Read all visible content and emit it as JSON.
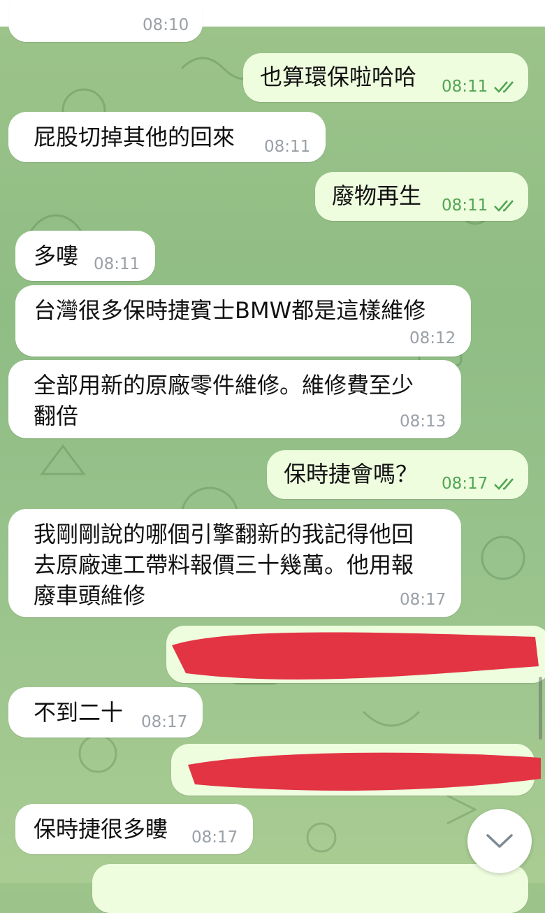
{
  "colors": {
    "incoming_bubble": "#ffffff",
    "outgoing_bubble": "#eefdde",
    "outgoing_time": "#52a553",
    "incoming_time": "#9aa0a6",
    "read_check": "#52a553",
    "redaction_mark": "#e33444"
  },
  "messages": [
    {
      "id": "m0",
      "direction": "in",
      "text": "",
      "time": "08:10",
      "partially_visible": true
    },
    {
      "id": "m1",
      "direction": "out",
      "text": "也算環保啦哈哈",
      "time": "08:11",
      "status": "read"
    },
    {
      "id": "m2",
      "direction": "in",
      "text": "屁股切掉其他的回來",
      "time": "08:11"
    },
    {
      "id": "m3",
      "direction": "out",
      "text": "廢物再生",
      "time": "08:11",
      "status": "read"
    },
    {
      "id": "m4",
      "direction": "in",
      "text": "多嘍",
      "time": "08:11"
    },
    {
      "id": "m5",
      "direction": "in",
      "text": "台灣很多保時捷賓士BMW都是這樣維修",
      "time": "08:12"
    },
    {
      "id": "m6",
      "direction": "in",
      "text": "全部用新的原廠零件維修。維修費至少\n翻倍",
      "time": "08:13"
    },
    {
      "id": "m7",
      "direction": "out",
      "text": "保時捷會嗎？",
      "time": "08:17",
      "status": "read"
    },
    {
      "id": "m8",
      "direction": "in",
      "text": "我剛剛說的哪個引擎翻新的我記得他回\n去原廠連工帶料報價三十幾萬。他用報\n廢車頭維修",
      "time": "08:17"
    },
    {
      "id": "m9",
      "direction": "out",
      "text": "",
      "time": "",
      "redacted": true
    },
    {
      "id": "m10",
      "direction": "in",
      "text": "不到二十",
      "time": "08:17"
    },
    {
      "id": "m11",
      "direction": "out",
      "text": "",
      "time": "",
      "redacted": true
    },
    {
      "id": "m12",
      "direction": "in",
      "text": "保時捷很多瞜",
      "time": "08:17"
    },
    {
      "id": "m13",
      "direction": "out",
      "text": "",
      "time": "",
      "partially_visible": true
    }
  ],
  "icons": {
    "read_receipt": "double-check-icon",
    "scroll_down": "chevron-down-icon"
  }
}
